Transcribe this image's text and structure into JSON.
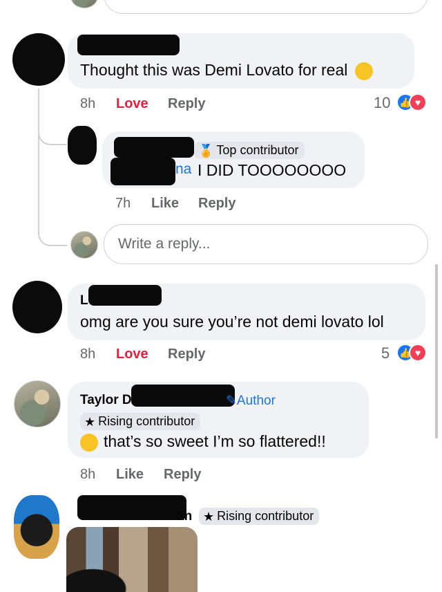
{
  "comments": [
    {
      "text": "Thought this was Demi Lovato for real",
      "time": "8h",
      "love": "Love",
      "reply": "Reply",
      "reaction_count": "10"
    },
    {
      "badge": "Top contributor",
      "name_tail": "na",
      "text": "I DID TOOOOOOOO",
      "time": "7h",
      "like": "Like",
      "reply": "Reply"
    },
    {
      "name_initial": "L",
      "text": "omg are you sure you’re not demi lovato lol",
      "time": "8h",
      "love": "Love",
      "reply": "Reply",
      "reaction_count": "5"
    },
    {
      "name": "Taylor D",
      "author_label": "Author",
      "badge": "Rising contributor",
      "text": "that’s so sweet I’m so flattered!!",
      "time": "8h",
      "like": "Like",
      "reply": "Reply"
    },
    {
      "name_tail": "an",
      "badge": "Rising contributor"
    }
  ],
  "reply_input": {
    "placeholder": "Write a reply..."
  },
  "colors": {
    "bubble": "#f0f2f5",
    "love": "#e41e3f",
    "like_icon": "#1877f2",
    "love_icon": "#f33e58",
    "author": "#1b74e4"
  },
  "icons": [
    "like-reaction-icon",
    "love-reaction-icon",
    "loudly-crying-emoji",
    "laughing-tears-emoji",
    "star-icon",
    "badge-medal-icon",
    "pencil-icon"
  ]
}
